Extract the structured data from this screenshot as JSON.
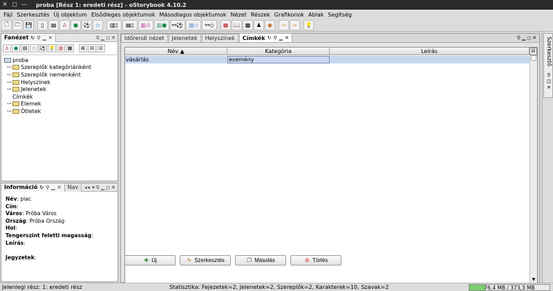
{
  "window": {
    "title": "proba [Rész 1: eredeti rész] - oStorybook 4.10.2"
  },
  "menu": [
    "Fájl",
    "Szerkesztés",
    "Új objektum",
    "Elsődleges objektumok",
    "Másodlagos objektumok",
    "Nézet",
    "Részek",
    "Grafikonok",
    "Ablak",
    "Segítség"
  ],
  "tree_panel": {
    "tab": "Fanézet",
    "items": [
      {
        "label": "proba",
        "level": 0,
        "expander": false,
        "folder": true,
        "root": true
      },
      {
        "label": "Szereplők kategóriánként",
        "level": 1,
        "expander": true,
        "folder": true
      },
      {
        "label": "Szereplők nemenként",
        "level": 1,
        "expander": true,
        "folder": true
      },
      {
        "label": "Helyszínek",
        "level": 1,
        "expander": true,
        "folder": true
      },
      {
        "label": "Jelenetek",
        "level": 1,
        "expander": true,
        "folder": true
      },
      {
        "label": "Címkék",
        "level": 1,
        "expander": false,
        "folder": false
      },
      {
        "label": "Elemek",
        "level": 1,
        "expander": true,
        "folder": true
      },
      {
        "label": "Ötletek",
        "level": 1,
        "expander": true,
        "folder": true
      }
    ]
  },
  "info_panel": {
    "tab": "Információ",
    "tab2": "Nav",
    "lines": [
      {
        "label": "Név",
        "value": "piac"
      },
      {
        "label": "Cím",
        "value": ""
      },
      {
        "label": "Város",
        "value": "Próba Város"
      },
      {
        "label": "Ország",
        "value": "Próba Ország"
      },
      {
        "label": "Hol",
        "value": ""
      },
      {
        "label": "Tengerszint feletti magasság",
        "value": ""
      },
      {
        "label": "Leírás",
        "value": ""
      },
      {
        "label": "",
        "value": ""
      },
      {
        "label": "Jegyzetek",
        "value": ""
      }
    ]
  },
  "main_tabs": [
    {
      "label": "Időrendi nézet",
      "active": false
    },
    {
      "label": "Jelenetek",
      "active": false
    },
    {
      "label": "Helyszínek",
      "active": false
    },
    {
      "label": "Címkék",
      "active": true
    }
  ],
  "table": {
    "columns": [
      "Név ▲",
      "Kategória",
      "Leírás"
    ],
    "rows": [
      [
        "vásárlás",
        "esemény",
        ""
      ]
    ]
  },
  "buttons": [
    {
      "label": "Új",
      "icon": "new-icon",
      "glyph": "✚",
      "color": "#2f8a2f"
    },
    {
      "label": "Szerkesztés",
      "icon": "edit-icon",
      "glyph": "✎",
      "color": "#b07a10"
    },
    {
      "label": "Másolás",
      "icon": "copy-icon",
      "glyph": "❐",
      "color": "#555555"
    },
    {
      "label": "Törlés",
      "icon": "delete-icon",
      "glyph": "⊘",
      "color": "#cc2222"
    }
  ],
  "side_strip": {
    "label": "Szerkesztő"
  },
  "status": {
    "part": "Jelenlegi rész: 1: eredeti rész",
    "stats": "Statisztika: Fejezetek=2,  Jelenetek=2,  Szereplők=2,  Karakterek=10,  Szavak=2",
    "memory": "76,4 MB / 373,3 MB",
    "memory_fraction": 0.2
  }
}
